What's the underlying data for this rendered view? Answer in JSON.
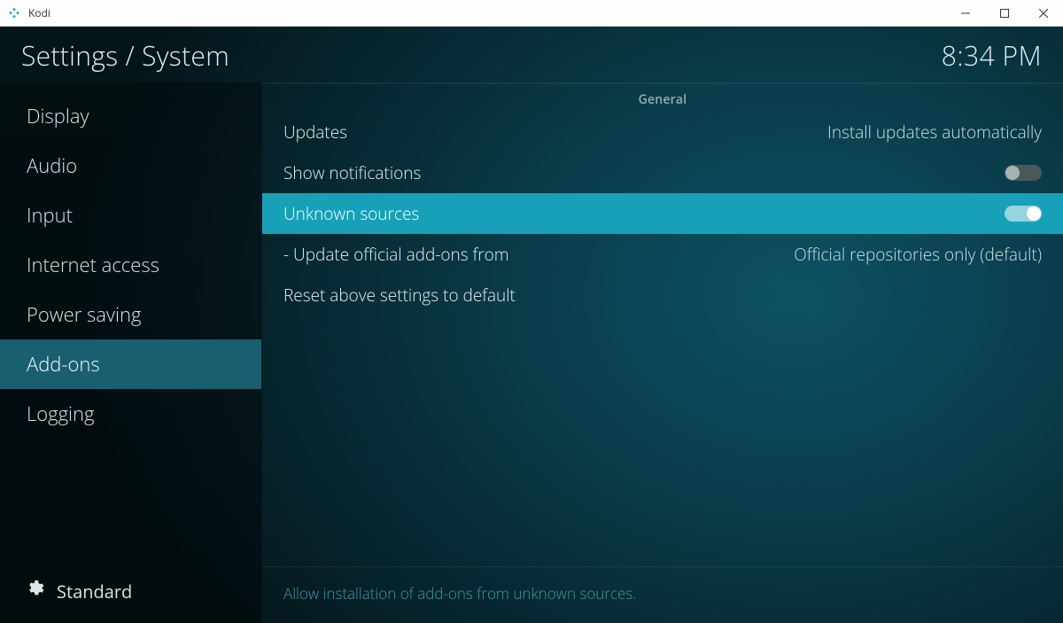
{
  "window": {
    "title": "Kodi"
  },
  "header": {
    "breadcrumb": "Settings / System",
    "clock": "8:34 PM"
  },
  "sidebar": {
    "items": [
      {
        "label": "Display",
        "active": false
      },
      {
        "label": "Audio",
        "active": false
      },
      {
        "label": "Input",
        "active": false
      },
      {
        "label": "Internet access",
        "active": false
      },
      {
        "label": "Power saving",
        "active": false
      },
      {
        "label": "Add-ons",
        "active": true
      },
      {
        "label": "Logging",
        "active": false
      }
    ],
    "level": "Standard"
  },
  "panel": {
    "section": "General",
    "settings": [
      {
        "label": "Updates",
        "type": "value",
        "value": "Install updates automatically"
      },
      {
        "label": "Show notifications",
        "type": "toggle",
        "on": false
      },
      {
        "label": "Unknown sources",
        "type": "toggle",
        "on": true,
        "highlight": true
      },
      {
        "label": "- Update official add-ons from",
        "type": "value",
        "value": "Official repositories only (default)"
      },
      {
        "label": "Reset above settings to default",
        "type": "action"
      }
    ],
    "description": "Allow installation of add-ons from unknown sources."
  }
}
